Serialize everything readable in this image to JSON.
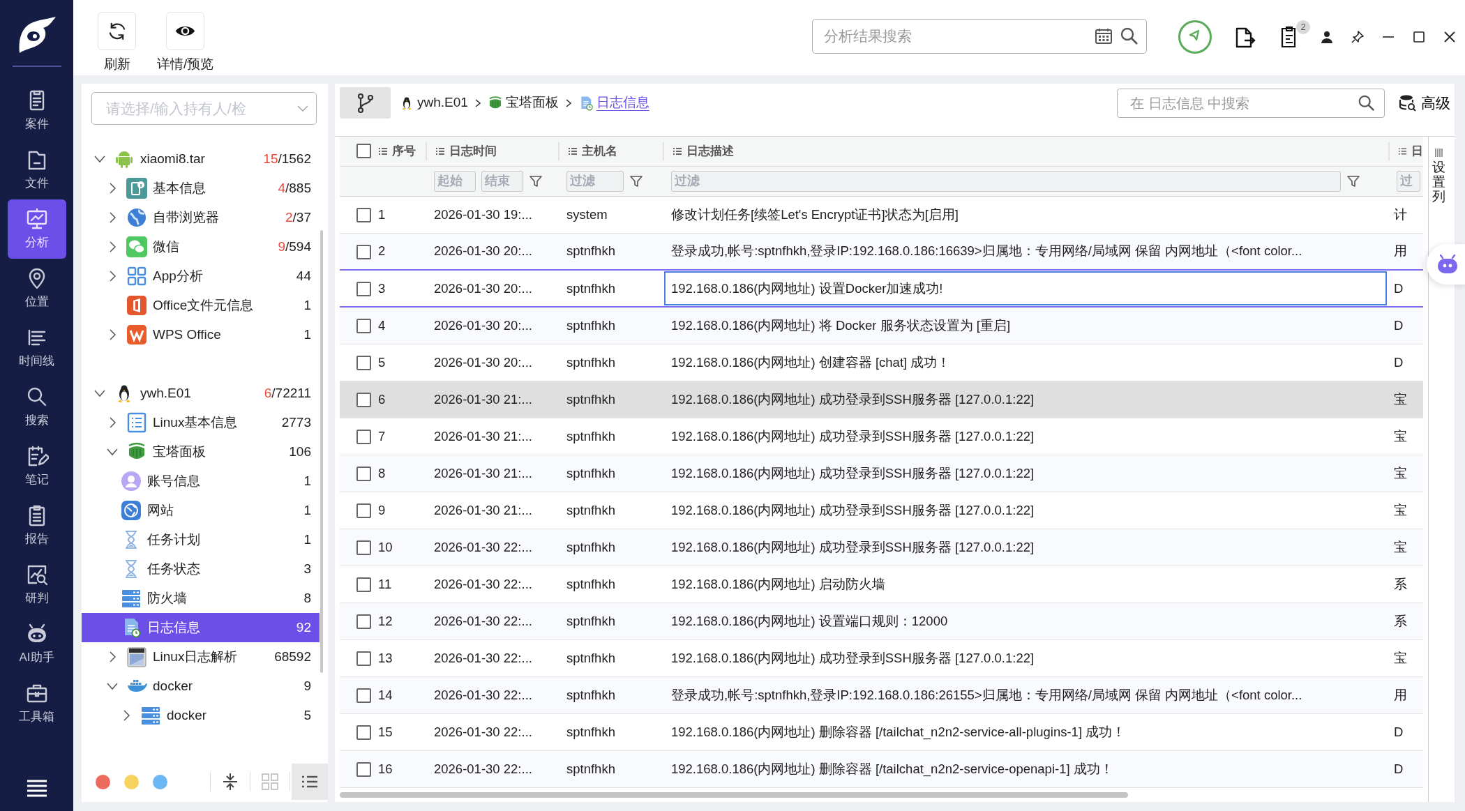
{
  "nav": {
    "items": [
      {
        "label": "案件",
        "kind": "case",
        "selected": false
      },
      {
        "label": "文件",
        "kind": "file",
        "selected": false
      },
      {
        "label": "分析",
        "kind": "analysis",
        "selected": true
      },
      {
        "label": "位置",
        "kind": "location",
        "selected": false
      },
      {
        "label": "时间线",
        "kind": "timeline",
        "selected": false
      },
      {
        "label": "搜索",
        "kind": "search",
        "selected": false
      },
      {
        "label": "笔记",
        "kind": "note",
        "selected": false
      },
      {
        "label": "报告",
        "kind": "report",
        "selected": false
      },
      {
        "label": "研判",
        "kind": "judge",
        "selected": false
      },
      {
        "label": "AI助手",
        "kind": "robot",
        "selected": false
      },
      {
        "label": "工具箱",
        "kind": "toolbox",
        "selected": false
      }
    ]
  },
  "toolbar": {
    "buttons": [
      {
        "label": "刷新",
        "kind": "refresh"
      },
      {
        "label": "详情/预览",
        "kind": "preview"
      }
    ],
    "search": {
      "placeholder": "分析结果搜索"
    },
    "actions": [
      {
        "kind": "status"
      },
      {
        "kind": "export"
      },
      {
        "kind": "tasks",
        "badge": "2"
      }
    ],
    "window_controls": [
      {
        "kind": "user"
      },
      {
        "kind": "pin"
      },
      {
        "kind": "minimize"
      },
      {
        "kind": "maximize"
      },
      {
        "kind": "close"
      }
    ]
  },
  "tree": {
    "owner_select": {
      "placeholder": "请选择/输入持有人/检"
    },
    "items": [
      {
        "label": "xiaomi8.tar",
        "kind": "android",
        "hits": "15",
        "count": "/1562",
        "expanded": true,
        "selected": false,
        "children": [
          {
            "label": "基本信息",
            "kind": "info",
            "hits": "4",
            "count": "/885",
            "expanded": false,
            "selected": false
          },
          {
            "label": "自带浏览器",
            "kind": "browser",
            "hits": "2",
            "count": "/37",
            "expanded": false,
            "selected": false
          },
          {
            "label": "微信",
            "kind": "wechat",
            "hits": "9",
            "count": "/594",
            "expanded": false,
            "selected": false
          },
          {
            "label": "App分析",
            "kind": "apps",
            "count": "44",
            "expanded": false,
            "selected": false
          },
          {
            "label": "Office文件元信息",
            "kind": "office",
            "count": "1",
            "selected": false
          },
          {
            "label": "WPS Office",
            "kind": "wps",
            "count": "1",
            "expanded": false,
            "selected": false
          }
        ]
      },
      {
        "label": "ywh.E01",
        "kind": "linux",
        "hits": "6",
        "count": "/72211",
        "expanded": true,
        "selected": false,
        "children": [
          {
            "label": "Linux基本信息",
            "kind": "list",
            "count": "2773",
            "expanded": false,
            "selected": false
          },
          {
            "label": "宝塔面板",
            "kind": "shield",
            "count": "106",
            "expanded": true,
            "selected": false,
            "children": [
              {
                "label": "账号信息",
                "kind": "user",
                "count": "1",
                "selected": false
              },
              {
                "label": "网站",
                "kind": "web",
                "count": "1",
                "selected": false
              },
              {
                "label": "任务计划",
                "kind": "hourglass",
                "count": "1",
                "selected": false
              },
              {
                "label": "任务状态",
                "kind": "hourglass",
                "count": "3",
                "selected": false
              },
              {
                "label": "防火墙",
                "kind": "server",
                "count": "8",
                "selected": false
              },
              {
                "label": "日志信息",
                "kind": "log",
                "count": "92",
                "selected": true
              }
            ]
          },
          {
            "label": "Linux日志解析",
            "kind": "logfile",
            "count": "68592",
            "expanded": false,
            "selected": false
          },
          {
            "label": "docker",
            "kind": "docker",
            "count": "9",
            "expanded": true,
            "selected": false,
            "children": [
              {
                "label": "docker",
                "kind": "server",
                "count": "5",
                "expanded": false,
                "selected": false
              }
            ]
          }
        ]
      }
    ],
    "color_dots": [
      {
        "color": "#ec6b5e"
      },
      {
        "color": "#f6d35f"
      },
      {
        "color": "#6cb8f5"
      }
    ],
    "view_buttons": [
      {
        "kind": "collapse",
        "selected": false
      },
      {
        "kind": "grid",
        "selected": false
      },
      {
        "kind": "list",
        "selected": true
      }
    ]
  },
  "breadcrumb": [
    {
      "label": "ywh.E01",
      "kind": "linux",
      "selected": false
    },
    {
      "label": "宝塔面板",
      "kind": "shield",
      "selected": false
    },
    {
      "label": "日志信息",
      "kind": "log",
      "selected": true
    }
  ],
  "content_search": {
    "placeholder": "在 日志信息 中搜索"
  },
  "advanced_button": {
    "label": "高级"
  },
  "column_settings": {
    "label": "设置列"
  },
  "table": {
    "header_checked": false,
    "columns": [
      {
        "label": "序号",
        "funnel": false
      },
      {
        "label": "日志时间",
        "funnel": true,
        "filters": [
          {
            "placeholder": "起始"
          },
          {
            "placeholder": "结束"
          }
        ]
      },
      {
        "label": "主机名",
        "funnel": true,
        "filters": [
          {
            "placeholder": "过滤"
          }
        ]
      },
      {
        "label": "日志描述",
        "funnel": true,
        "filters": [
          {
            "placeholder": "过滤"
          }
        ]
      },
      {
        "label": "日",
        "funnel": false,
        "filters": [
          {
            "placeholder": "过"
          }
        ]
      }
    ],
    "rows": [
      {
        "checked": false,
        "selected": false,
        "hovered": false,
        "cells": [
          "1",
          "2026-01-30 19:...",
          "system",
          "修改计划任务[续签Let's Encrypt证书]状态为[启用]",
          "计"
        ]
      },
      {
        "checked": false,
        "selected": false,
        "hovered": false,
        "cells": [
          "2",
          "2026-01-30 20:...",
          "sptnfhkh",
          "登录成功,帐号:sptnfhkh,登录IP:192.168.0.186:16639>归属地：专用网络/局域网 保留 内网地址（<font color...",
          "用"
        ]
      },
      {
        "checked": false,
        "selected": true,
        "hovered": false,
        "cells": [
          "3",
          "2026-01-30 20:...",
          "sptnfhkh",
          "192.168.0.186(内网地址) 设置Docker加速成功!",
          "D"
        ]
      },
      {
        "checked": false,
        "selected": false,
        "hovered": false,
        "cells": [
          "4",
          "2026-01-30 20:...",
          "sptnfhkh",
          "192.168.0.186(内网地址) 将 Docker 服务状态设置为 [重启]",
          "D"
        ]
      },
      {
        "checked": false,
        "selected": false,
        "hovered": false,
        "cells": [
          "5",
          "2026-01-30 20:...",
          "sptnfhkh",
          "192.168.0.186(内网地址) 创建容器 [chat] 成功！",
          "D"
        ]
      },
      {
        "checked": false,
        "selected": false,
        "hovered": true,
        "cells": [
          "6",
          "2026-01-30 21:...",
          "sptnfhkh",
          "192.168.0.186(内网地址) 成功登录到SSH服务器 [127.0.0.1:22]",
          "宝"
        ]
      },
      {
        "checked": false,
        "selected": false,
        "hovered": false,
        "cells": [
          "7",
          "2026-01-30 21:...",
          "sptnfhkh",
          "192.168.0.186(内网地址) 成功登录到SSH服务器 [127.0.0.1:22]",
          "宝"
        ]
      },
      {
        "checked": false,
        "selected": false,
        "hovered": false,
        "cells": [
          "8",
          "2026-01-30 21:...",
          "sptnfhkh",
          "192.168.0.186(内网地址) 成功登录到SSH服务器 [127.0.0.1:22]",
          "宝"
        ]
      },
      {
        "checked": false,
        "selected": false,
        "hovered": false,
        "cells": [
          "9",
          "2026-01-30 21:...",
          "sptnfhkh",
          "192.168.0.186(内网地址) 成功登录到SSH服务器 [127.0.0.1:22]",
          "宝"
        ]
      },
      {
        "checked": false,
        "selected": false,
        "hovered": false,
        "cells": [
          "10",
          "2026-01-30 22:...",
          "sptnfhkh",
          "192.168.0.186(内网地址) 成功登录到SSH服务器 [127.0.0.1:22]",
          "宝"
        ]
      },
      {
        "checked": false,
        "selected": false,
        "hovered": false,
        "cells": [
          "11",
          "2026-01-30 22:...",
          "sptnfhkh",
          "192.168.0.186(内网地址) 启动防火墙",
          "系"
        ]
      },
      {
        "checked": false,
        "selected": false,
        "hovered": false,
        "cells": [
          "12",
          "2026-01-30 22:...",
          "sptnfhkh",
          "192.168.0.186(内网地址) 设置端口规则：12000",
          "系"
        ]
      },
      {
        "checked": false,
        "selected": false,
        "hovered": false,
        "cells": [
          "13",
          "2026-01-30 22:...",
          "sptnfhkh",
          "192.168.0.186(内网地址) 成功登录到SSH服务器 [127.0.0.1:22]",
          "宝"
        ]
      },
      {
        "checked": false,
        "selected": false,
        "hovered": false,
        "cells": [
          "14",
          "2026-01-30 22:...",
          "sptnfhkh",
          "登录成功,帐号:sptnfhkh,登录IP:192.168.0.186:26155>归属地：专用网络/局域网 保留 内网地址（<font color...",
          "用"
        ]
      },
      {
        "checked": false,
        "selected": false,
        "hovered": false,
        "cells": [
          "15",
          "2026-01-30 22:...",
          "sptnfhkh",
          "192.168.0.186(内网地址) 删除容器 [/tailchat_n2n2-service-all-plugins-1] 成功！",
          "D"
        ]
      },
      {
        "checked": false,
        "selected": false,
        "hovered": false,
        "cells": [
          "16",
          "2026-01-30 22:...",
          "sptnfhkh",
          "192.168.0.186(内网地址) 删除容器 [/tailchat_n2n2-service-openapi-1] 成功！",
          "D"
        ]
      }
    ]
  }
}
